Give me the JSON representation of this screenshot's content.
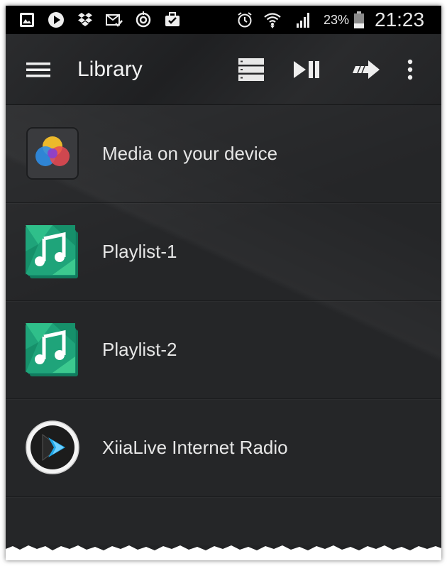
{
  "status_bar": {
    "battery_percent": "23%",
    "time": "21:23",
    "icons": [
      "gallery-icon",
      "play-icon",
      "dropbox-icon",
      "mail-check-icon",
      "sync-icon",
      "briefcase-icon",
      "alarm-icon",
      "wifi-icon",
      "signal-icon",
      "battery-icon"
    ]
  },
  "action_bar": {
    "title": "Library",
    "icons": [
      "menu-icon",
      "queue-icon",
      "play-pause-icon",
      "forward-arrow-icon",
      "overflow-menu-icon"
    ]
  },
  "library": {
    "items": [
      {
        "label": "Media on your device",
        "icon": "media-device-icon"
      },
      {
        "label": "Playlist-1",
        "icon": "playlist-icon"
      },
      {
        "label": "Playlist-2",
        "icon": "playlist-icon"
      },
      {
        "label": "XiiaLive Internet Radio",
        "icon": "xiialive-icon"
      }
    ]
  },
  "colors": {
    "background": "#252628",
    "status_bar": "#000000",
    "text": "#e6e6e6",
    "playlist_green": "#1fa47a"
  }
}
